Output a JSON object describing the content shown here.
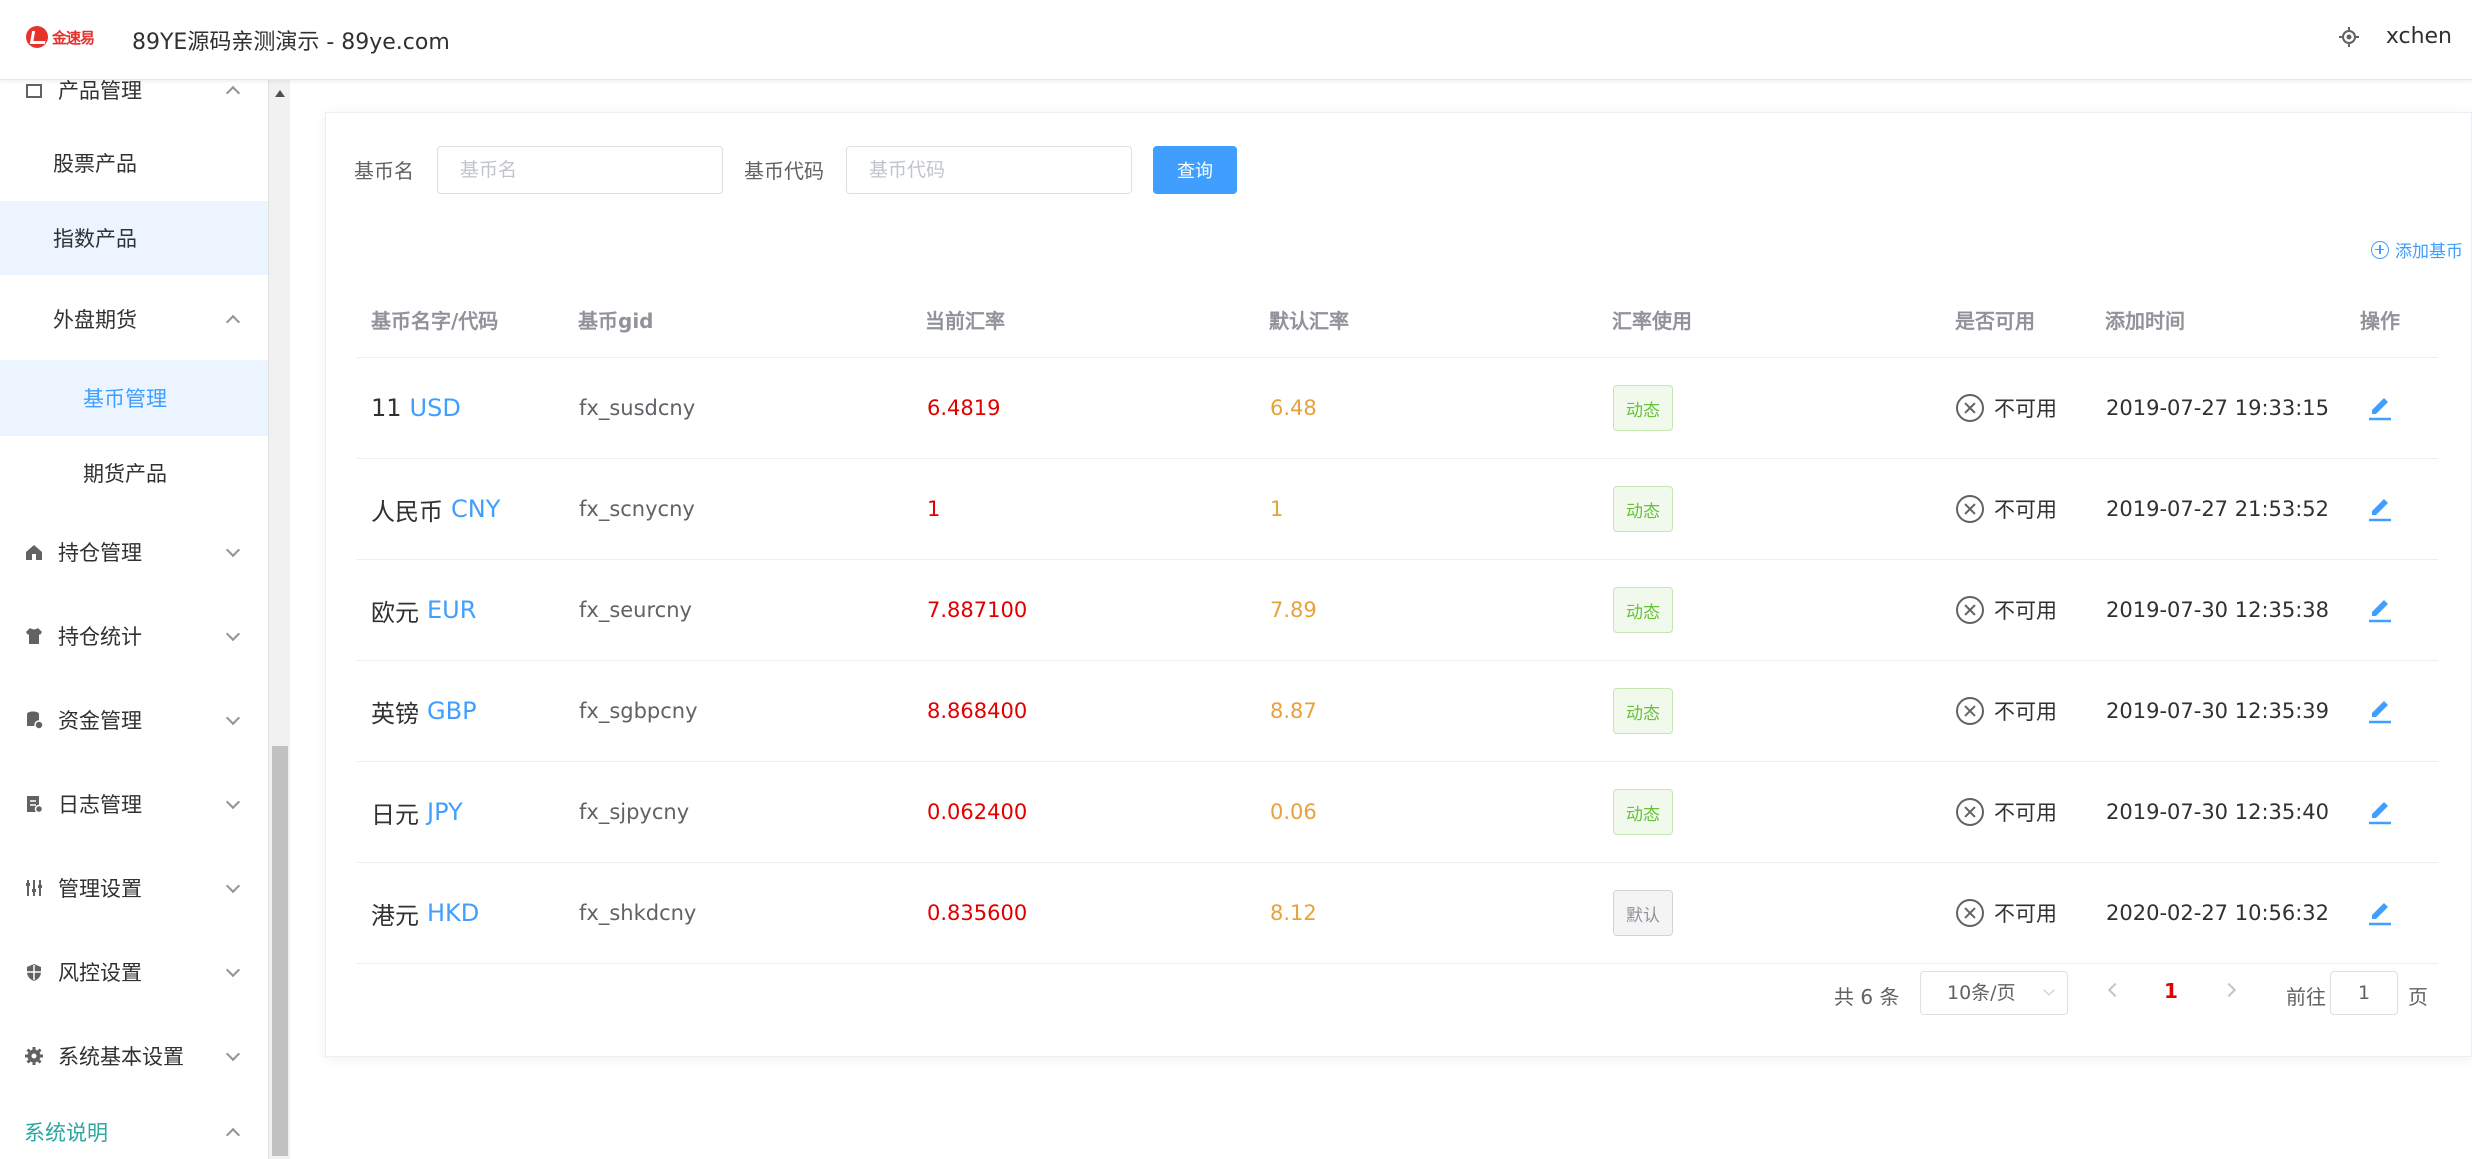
{
  "header": {
    "logo_text": "金速易",
    "title": "89YE源码亲测演示 - 89ye.com",
    "username": "xchen"
  },
  "sidebar": {
    "top_partial": "产品管理",
    "items": [
      {
        "label": "股票产品"
      },
      {
        "label": "指数产品"
      },
      {
        "label": "外盘期货"
      },
      {
        "label": "基币管理"
      },
      {
        "label": "期货产品"
      },
      {
        "label": "持仓管理",
        "icon": "house-icon"
      },
      {
        "label": "持仓统计",
        "icon": "shirt-icon"
      },
      {
        "label": "资金管理",
        "icon": "database-icon"
      },
      {
        "label": "日志管理",
        "icon": "document-icon"
      },
      {
        "label": "管理设置",
        "icon": "sliders-icon"
      },
      {
        "label": "风控设置",
        "icon": "shield-icon"
      },
      {
        "label": "系统基本设置",
        "icon": "gear-icon"
      },
      {
        "label": "系统说明"
      }
    ]
  },
  "search": {
    "name_label": "基币名",
    "name_placeholder": "基币名",
    "code_label": "基币代码",
    "code_placeholder": "基币代码",
    "query_button": "查询"
  },
  "add_link": "添加基币",
  "table": {
    "headers": [
      "基币名字/代码",
      "基币gid",
      "当前汇率",
      "默认汇率",
      "汇率使用",
      "是否可用",
      "添加时间",
      "操作"
    ],
    "rows": [
      {
        "name": "11",
        "code": "USD",
        "gid": "fx_susdcny",
        "rate": "6.4819",
        "default_rate": "6.48",
        "usage": "动态",
        "usage_type": "dynamic",
        "status": "不可用",
        "time": "2019-07-27 19:33:15"
      },
      {
        "name": "人民币",
        "code": "CNY",
        "gid": "fx_scnycny",
        "rate": "1",
        "default_rate": "1",
        "usage": "动态",
        "usage_type": "dynamic",
        "status": "不可用",
        "time": "2019-07-27 21:53:52"
      },
      {
        "name": "欧元",
        "code": "EUR",
        "gid": "fx_seurcny",
        "rate": "7.887100",
        "default_rate": "7.89",
        "usage": "动态",
        "usage_type": "dynamic",
        "status": "不可用",
        "time": "2019-07-30 12:35:38"
      },
      {
        "name": "英镑",
        "code": "GBP",
        "gid": "fx_sgbpcny",
        "rate": "8.868400",
        "default_rate": "8.87",
        "usage": "动态",
        "usage_type": "dynamic",
        "status": "不可用",
        "time": "2019-07-30 12:35:39"
      },
      {
        "name": "日元",
        "code": "JPY",
        "gid": "fx_sjpycny",
        "rate": "0.062400",
        "default_rate": "0.06",
        "usage": "动态",
        "usage_type": "dynamic",
        "status": "不可用",
        "time": "2019-07-30 12:35:40"
      },
      {
        "name": "港元",
        "code": "HKD",
        "gid": "fx_shkdcny",
        "rate": "0.835600",
        "default_rate": "8.12",
        "usage": "默认",
        "usage_type": "default",
        "status": "不可用",
        "time": "2020-02-27 10:56:32"
      }
    ]
  },
  "pagination": {
    "total": "共 6 条",
    "page_size": "10条/页",
    "current_page": "1",
    "goto_label": "前往",
    "goto_value": "1",
    "page_suffix": "页"
  },
  "colors": {
    "accent": "#409eff",
    "rate": "#e00000",
    "default_rate": "#e6a23c",
    "tag_green": "#67c23a"
  }
}
